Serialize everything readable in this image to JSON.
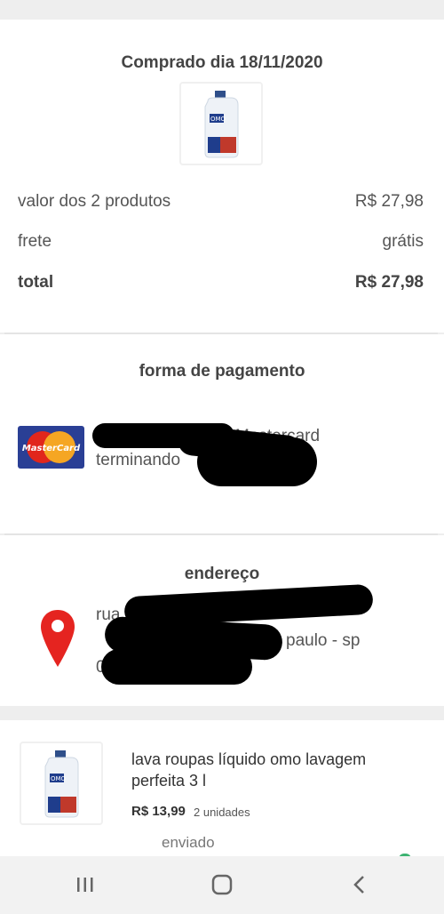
{
  "order": {
    "purchased_label": "Comprado dia 18/11/2020",
    "summary": [
      {
        "label": "valor dos 2 produtos",
        "value": "R$ 27,98"
      },
      {
        "label": "frete",
        "value": "grátis"
      },
      {
        "label": "total",
        "value": "R$ 27,98"
      }
    ]
  },
  "payment": {
    "heading": "forma de pagamento",
    "card_brand": "MasterCard",
    "line1": "Mastercard",
    "line2": "terminando"
  },
  "address": {
    "heading": "endereço",
    "line1": "rua",
    "line2": "paulo - sp",
    "line3": "0"
  },
  "product": {
    "name_line1": "lava roupas líquido omo lavagem",
    "name_line2": "perfeita 3 l",
    "price": "R$ 13,99",
    "quantity": "2 unidades",
    "status": "enviado"
  },
  "icons": {
    "pin": "location-pin-icon",
    "nav_recent": "recent-apps-icon",
    "nav_home": "home-icon",
    "nav_back": "back-icon"
  },
  "colors": {
    "pin": "#e52420",
    "mastercard_bg": "#2a3f95",
    "mastercard_red": "#e1261c",
    "mastercard_yellow": "#f5a623"
  }
}
